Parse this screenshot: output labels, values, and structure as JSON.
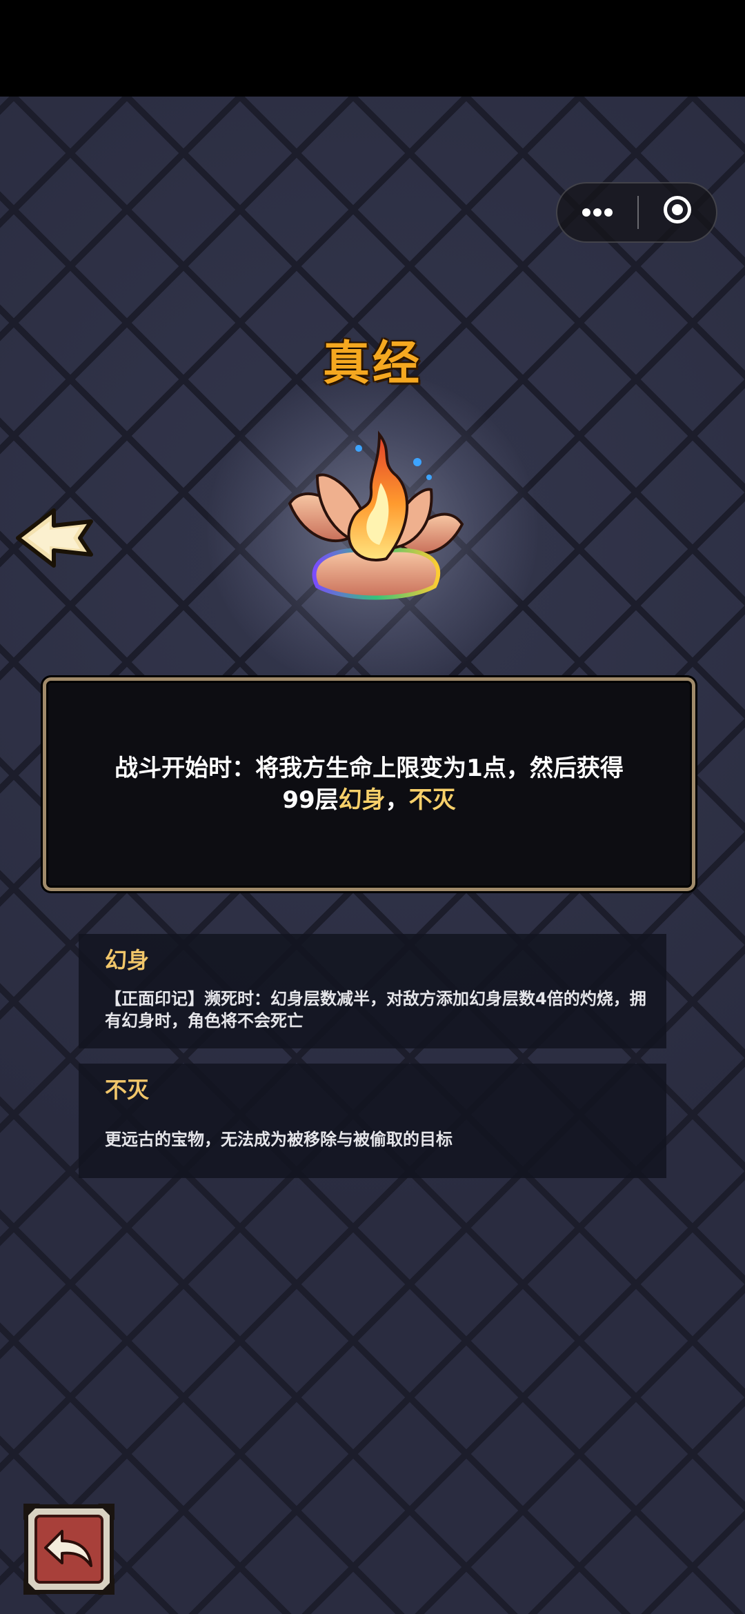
{
  "capsule": {
    "more_icon": "more-dots-icon",
    "close_icon": "target-circle-icon"
  },
  "item": {
    "title": "真经",
    "icon": "lotus-flame-icon"
  },
  "description": {
    "line1": "战斗开始时：将我方生命上限变为1点，然后获得",
    "line2_prefix": "99层",
    "keyword1": "幻身",
    "separator": "，",
    "keyword2": "不灭"
  },
  "keywords": [
    {
      "title": "幻身",
      "body": "【正面印记】濒死时：幻身层数减半，对敌方添加幻身层数4倍的灼烧，拥有幻身时，角色将不会死亡"
    },
    {
      "title": "不灭",
      "body": "更远古的宝物，无法成为被移除与被偷取的目标"
    }
  ],
  "controls": {
    "prev_icon": "left-arrow-icon",
    "return_icon": "return-arrow-icon"
  },
  "colors": {
    "title": "#f5a820",
    "highlight": "#f7d06a",
    "panel_border": "#a08a6a",
    "background": "#2a2c40"
  }
}
